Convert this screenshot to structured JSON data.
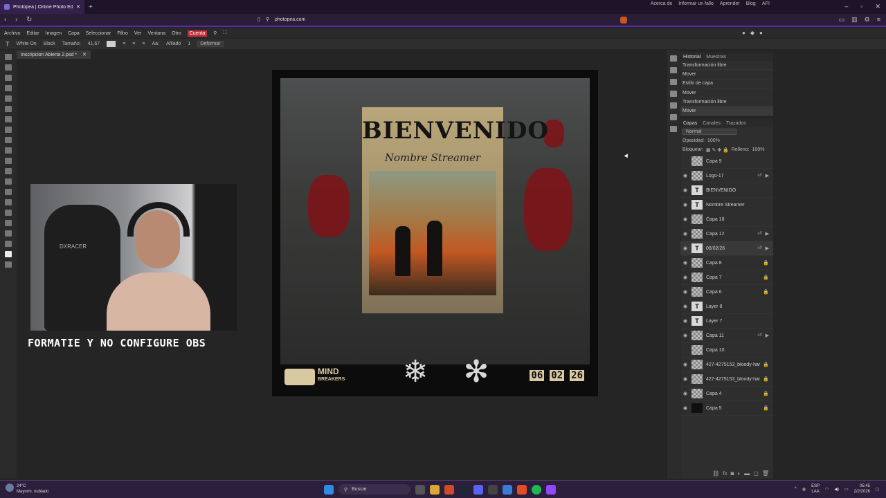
{
  "browser": {
    "tab_title": "Photopea | Online Photo Editor",
    "url": "photopea.com"
  },
  "menu": {
    "items": [
      "Archivo",
      "Editar",
      "Imagen",
      "Capa",
      "Seleccionar",
      "Filtro",
      "Ver",
      "Ventana",
      "Otro"
    ],
    "account": "Cuenta",
    "right_links": [
      "Acerca de",
      "Informar un fallo",
      "Aprender",
      "Blog",
      "API"
    ]
  },
  "options": {
    "font": "White On",
    "style": "Black",
    "size_label": "Tamaño:",
    "size_value": "41,67",
    "aa_label": "Aa:",
    "aa_value": "Afilado",
    "spacing_value": "1",
    "warp_button": "Deformar"
  },
  "document": {
    "tab_title": "Inscripcion Abierta 2.psd *",
    "poster_title": "BIENVENIDO",
    "poster_subtitle": "Nombre Streamer",
    "brand_top": "MIND",
    "brand_bottom": "BREAKERS",
    "date_parts": [
      "06",
      "02",
      "26"
    ]
  },
  "webcam": {
    "caption": "FORMATIE Y NO CONFIGURE OBS",
    "chair_brand": "DXRACER"
  },
  "history": {
    "tabs": [
      "Historial",
      "Muestras"
    ],
    "items": [
      "Transformación libre",
      "Mover",
      "Estilo de capa",
      "Mover",
      "Transformación libre",
      "Mover"
    ]
  },
  "layers_panel": {
    "tabs": [
      "Capas",
      "Canales",
      "Trazados"
    ],
    "blend_mode": "Normal",
    "opacity_label": "Opacidad:",
    "opacity_value": "100%",
    "lock_label": "Bloquear:",
    "fill_label": "Relleno:",
    "fill_value": "100%",
    "layers": [
      {
        "name": "Capa 9",
        "kind": "raster",
        "visible": false
      },
      {
        "name": "Logo-17",
        "kind": "raster",
        "visible": true,
        "fx": true
      },
      {
        "name": "BIENVENIDO",
        "kind": "text",
        "visible": true
      },
      {
        "name": "Nombre Streamer",
        "kind": "text",
        "visible": true
      },
      {
        "name": "Capa 18",
        "kind": "raster",
        "visible": true
      },
      {
        "name": "Capa 12",
        "kind": "raster",
        "visible": true,
        "fx": true
      },
      {
        "name": "06/02/26",
        "kind": "text",
        "visible": true,
        "fx": true,
        "highlighted": true
      },
      {
        "name": "Capa 8",
        "kind": "raster",
        "visible": true,
        "locked": true
      },
      {
        "name": "Capa 7",
        "kind": "raster",
        "visible": true,
        "locked": true
      },
      {
        "name": "Capa 6",
        "kind": "raster",
        "visible": true,
        "locked": true
      },
      {
        "name": "Layer 8",
        "kind": "text",
        "visible": true
      },
      {
        "name": "Layer 7",
        "kind": "text",
        "visible": true
      },
      {
        "name": "Capa 11",
        "kind": "raster",
        "visible": true,
        "fx": true
      },
      {
        "name": "Capa 10",
        "kind": "raster",
        "visible": false
      },
      {
        "name": "427-4275153_bloody-har",
        "kind": "raster",
        "visible": true,
        "locked": true
      },
      {
        "name": "427-4275153_bloody-har",
        "kind": "raster",
        "visible": true,
        "locked": true
      },
      {
        "name": "Capa 4",
        "kind": "raster",
        "visible": true,
        "locked": true
      },
      {
        "name": "Capa 5",
        "kind": "dark",
        "visible": true,
        "locked": true
      }
    ]
  },
  "taskbar": {
    "temperature": "24°C",
    "weather": "Mayorm. nublado",
    "search_placeholder": "Buscar",
    "lang_top": "ESP",
    "lang_bottom": "LAA",
    "time": "05:45",
    "date": "2/2/2026"
  },
  "colors": {
    "accent_purple": "#5b2aa8",
    "account_red": "#c3303a",
    "poster_paper": "#b9a67a",
    "blood_red": "#7d1418"
  }
}
